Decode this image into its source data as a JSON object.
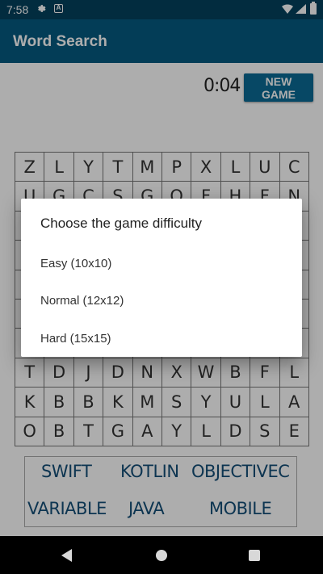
{
  "status_bar": {
    "time": "7:58",
    "notif_icon_letter": "A"
  },
  "app_bar": {
    "title": "Word Search"
  },
  "game": {
    "timer": "0:04",
    "new_game_label": "NEW GAME",
    "grid_rows": [
      [
        "Z",
        "L",
        "Y",
        "T",
        "M",
        "P",
        "X",
        "L",
        "U",
        "C"
      ],
      [
        "U",
        "G",
        "C",
        "S",
        "G",
        "O",
        "F",
        "H",
        "F",
        "N"
      ],
      [
        "",
        "",
        "",
        "",
        "",
        "",
        "",
        "",
        "",
        ""
      ],
      [
        "",
        "",
        "",
        "",
        "",
        "",
        "",
        "",
        "",
        ""
      ],
      [
        "",
        "",
        "",
        "",
        "",
        "",
        "",
        "",
        "",
        ""
      ],
      [
        "",
        "",
        "",
        "",
        "",
        "",
        "",
        "",
        "",
        ""
      ],
      [
        "",
        "",
        "",
        "",
        "",
        "",
        "",
        "",
        "",
        ""
      ],
      [
        "T",
        "D",
        "J",
        "D",
        "N",
        "X",
        "W",
        "B",
        "F",
        "L"
      ],
      [
        "K",
        "B",
        "B",
        "K",
        "M",
        "S",
        "Y",
        "U",
        "L",
        "A"
      ],
      [
        "O",
        "B",
        "T",
        "G",
        "A",
        "Y",
        "L",
        "D",
        "S",
        "E"
      ]
    ],
    "words": [
      "SWIFT",
      "KOTLIN",
      "OBJECTIVEC",
      "VARIABLE",
      "JAVA",
      "MOBILE"
    ]
  },
  "dialog": {
    "title": "Choose the game difficulty",
    "options": [
      "Easy (10x10)",
      "Normal (12x12)",
      "Hard (15x15)"
    ]
  }
}
